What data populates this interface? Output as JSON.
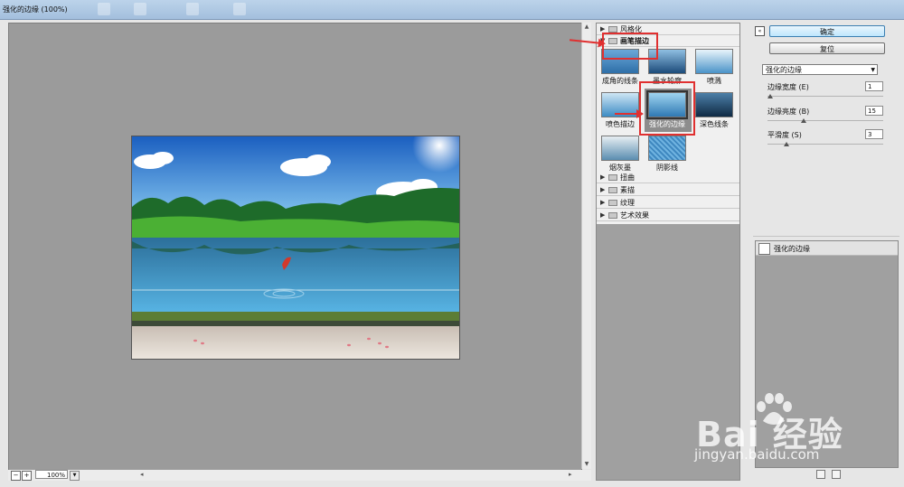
{
  "window": {
    "title": "强化的边缘 (100%)"
  },
  "preview": {
    "zoom_value": "100%"
  },
  "filter_gallery": {
    "categories_top": [
      {
        "label": "风格化",
        "open": false
      },
      {
        "label": "画笔描边",
        "open": true
      }
    ],
    "thumbnails": [
      {
        "label": "成角的线条",
        "selected": false
      },
      {
        "label": "墨水轮廓",
        "selected": false
      },
      {
        "label": "喷溅",
        "selected": false
      },
      {
        "label": "喷色描边",
        "selected": false
      },
      {
        "label": "强化的边缘",
        "selected": true
      },
      {
        "label": "深色线条",
        "selected": false
      },
      {
        "label": "烟灰墨",
        "selected": false
      },
      {
        "label": "阴影线",
        "selected": false
      }
    ],
    "categories_bottom": [
      {
        "label": "扭曲"
      },
      {
        "label": "素描"
      },
      {
        "label": "纹理"
      },
      {
        "label": "艺术效果"
      }
    ]
  },
  "settings": {
    "ok_label": "确定",
    "reset_label": "复位",
    "filter_select": "强化的边缘",
    "params": [
      {
        "label": "边缘宽度 (E)",
        "value": "1",
        "fraction": 0.0
      },
      {
        "label": "边缘亮度 (B)",
        "value": "15",
        "fraction": 0.3
      },
      {
        "label": "平滑度 (S)",
        "value": "3",
        "fraction": 0.15
      }
    ]
  },
  "layers": {
    "active_effect": "强化的边缘"
  },
  "watermark": {
    "logo": "Bai 经验",
    "url": "jingyan.baidu.com"
  },
  "colors": {
    "annotation_red": "#e03030",
    "sky_top": "#1b5fc0",
    "lake": "#3a9ad0"
  }
}
